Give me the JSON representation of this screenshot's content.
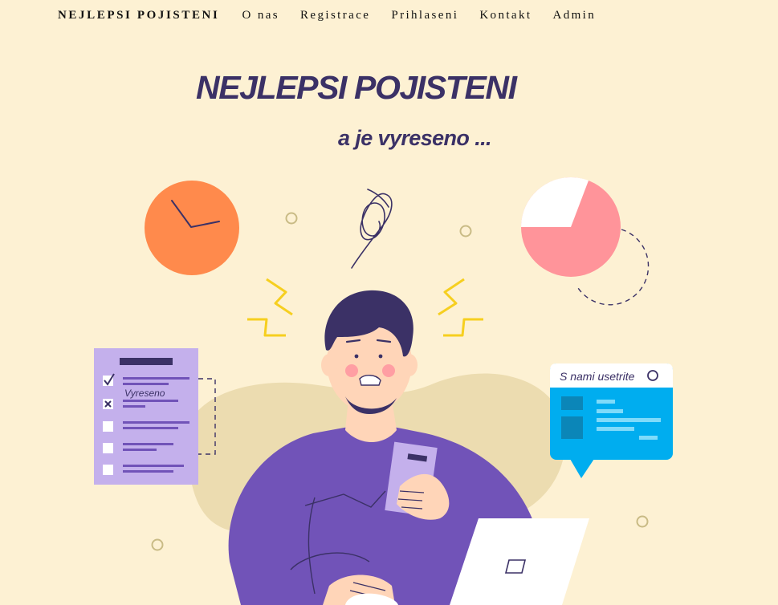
{
  "nav": {
    "brand": "NEJLEPSI POJISTENI",
    "links": [
      {
        "label": "O nas"
      },
      {
        "label": "Registrace"
      },
      {
        "label": "Prihlaseni"
      },
      {
        "label": "Kontakt"
      },
      {
        "label": "Admin"
      }
    ]
  },
  "hero": {
    "title": "NEJLEPSI POJISTENI",
    "subtitle": "a je vyreseno ...",
    "checklist_item": "Vyreseno",
    "chat_bubble_text": "S nami usetrite"
  },
  "colors": {
    "background": "#fdf1d3",
    "text": "#111111",
    "title": "#3b3166",
    "shirt": "#7153b8",
    "hair": "#3b3166",
    "skin": "#ffd5b8",
    "clock": "#ff8a4c",
    "pie": "#ff949a",
    "bubble": "#00adef",
    "checklist": "#c4b0ec",
    "blob": "#ecdcb0",
    "spark": "#f6cf1f"
  }
}
